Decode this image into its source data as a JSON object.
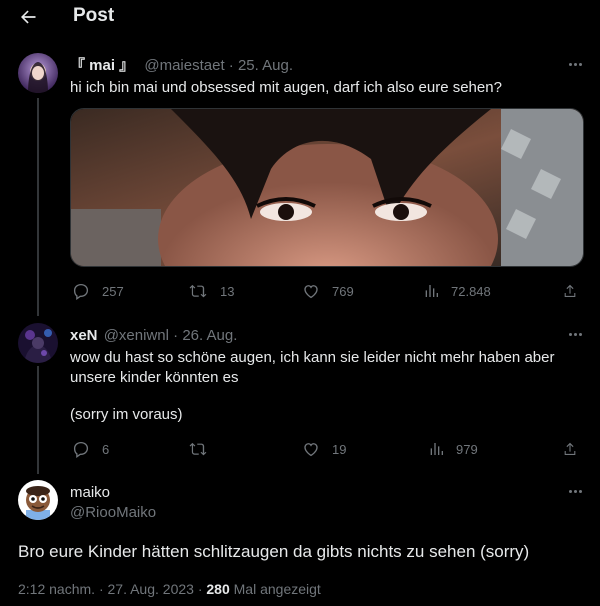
{
  "header": {
    "title": "Post"
  },
  "tweets": [
    {
      "name": "『 mai 』",
      "handle": "@maiestaet",
      "separator": "·",
      "date": "25. Aug.",
      "text": "hi ich bin mai und obsessed mit augen, darf ich also eure sehen?",
      "replies": "257",
      "retweets": "13",
      "likes": "769",
      "views": "72.848"
    },
    {
      "name": "xeN",
      "handle": "@xeniwnl",
      "separator": "·",
      "date": "26. Aug.",
      "text_lines": [
        "wow du hast so schöne augen, ich kann sie leider nicht mehr haben aber",
        "unsere kinder könnten es",
        "(sorry im voraus)"
      ],
      "replies": "6",
      "retweets": "",
      "likes": "19",
      "views": "979"
    }
  ],
  "main_post": {
    "name": "maiko",
    "handle": "@RiooMaiko",
    "text": "Bro eure Kinder hätten schlitzaugen da gibts nichts zu sehen (sorry)",
    "time": "2:12 nachm.",
    "date": "27. Aug. 2023",
    "separator": "·",
    "views_count": "280",
    "views_label": "Mal angezeigt"
  },
  "colors": {
    "background": "#000000",
    "text": "#e7e9ea",
    "muted": "#71767b",
    "thread_line": "#333639"
  },
  "icons": [
    "back-arrow-icon",
    "more-icon",
    "reply-icon",
    "retweet-icon",
    "like-icon",
    "views-icon",
    "share-icon"
  ]
}
